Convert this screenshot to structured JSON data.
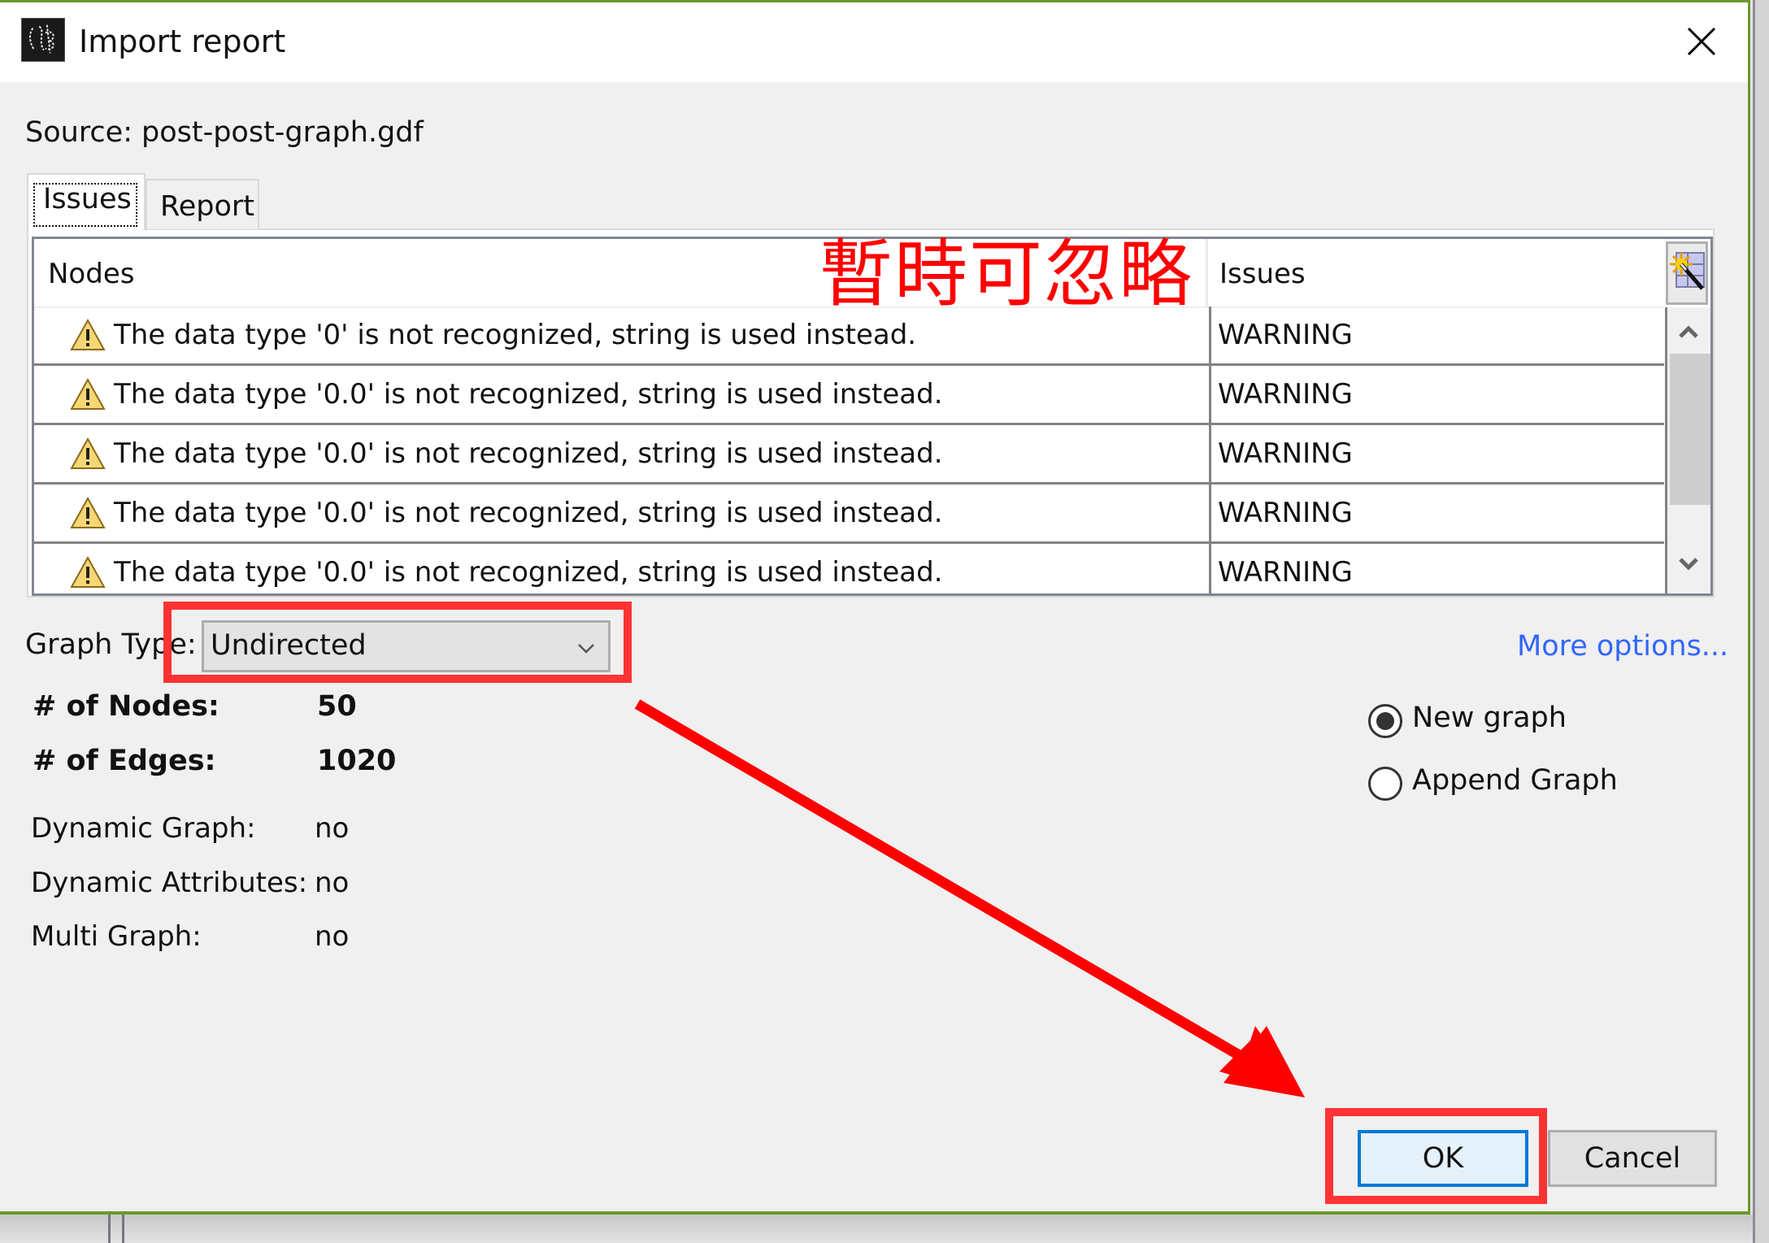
{
  "window": {
    "title": "Import report",
    "app_icon": "gephi-logo-icon",
    "close_icon": "close-icon"
  },
  "source": {
    "label": "Source:",
    "value": "post-post-graph.gdf"
  },
  "tabs": [
    {
      "label": "Issues",
      "selected": true
    },
    {
      "label": "Report",
      "selected": false
    }
  ],
  "table": {
    "columns": [
      "Nodes",
      "Issues"
    ],
    "corner_icon": "table-wizard-icon",
    "rows": [
      {
        "icon": "warning-icon",
        "message": "The data type '0' is not recognized, string is used instead.",
        "issue": "WARNING"
      },
      {
        "icon": "warning-icon",
        "message": "The data type '0.0' is not recognized, string is used instead.",
        "issue": "WARNING"
      },
      {
        "icon": "warning-icon",
        "message": "The data type '0.0' is not recognized, string is used instead.",
        "issue": "WARNING"
      },
      {
        "icon": "warning-icon",
        "message": "The data type '0.0' is not recognized, string is used instead.",
        "issue": "WARNING"
      },
      {
        "icon": "warning-icon",
        "message": "The data type '0.0' is not recognized, string is used instead.",
        "issue": "WARNING"
      }
    ]
  },
  "annotation": {
    "text": "暫時可忽略",
    "color": "#ff0000",
    "box_color": "#ff3333"
  },
  "graph_type": {
    "label": "Graph Type:",
    "selected": "Undirected"
  },
  "stats": {
    "nodes_label": "# of Nodes:",
    "nodes_value": "50",
    "edges_label": "# of Edges:",
    "edges_value": "1020",
    "dynamic_graph_label": "Dynamic Graph:",
    "dynamic_graph_value": "no",
    "dynamic_attributes_label": "Dynamic Attributes:",
    "dynamic_attributes_value": "no",
    "multi_graph_label": "Multi Graph:",
    "multi_graph_value": "no"
  },
  "more_options": {
    "label": "More options...",
    "color": "#3366ff"
  },
  "mode": {
    "options": [
      {
        "label": "New graph",
        "checked": true
      },
      {
        "label": "Append Graph",
        "checked": false
      }
    ]
  },
  "buttons": {
    "ok": "OK",
    "cancel": "Cancel"
  },
  "colors": {
    "window_border": "#6a9a2a",
    "focus_blue": "#0078d7"
  }
}
